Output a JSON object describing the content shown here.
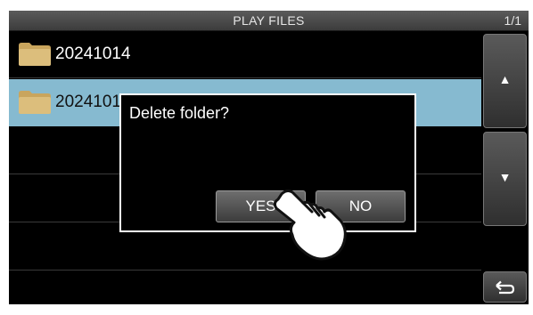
{
  "header": {
    "title": "PLAY FILES",
    "page": "1/1"
  },
  "folders": [
    {
      "name": "20241014",
      "selected": false
    },
    {
      "name": "2024101",
      "selected": true
    }
  ],
  "sidebar": {
    "up_icon": "▲",
    "down_icon": "▼",
    "back_icon": "return-arrow-icon"
  },
  "dialog": {
    "message": "Delete folder?",
    "yes_label": "YES",
    "no_label": "NO"
  },
  "colors": {
    "selected_row": "#86bad0",
    "screen_bg": "#000000",
    "folder_yellow": "#d7b56b"
  }
}
